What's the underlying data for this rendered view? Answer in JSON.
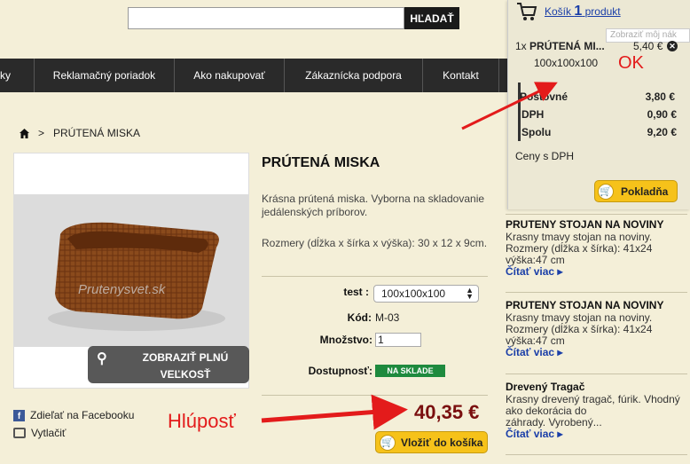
{
  "search": {
    "value": "",
    "button_label": "HĽADAŤ"
  },
  "nav": {
    "items": [
      "ky",
      "Reklamačný poriadok",
      "Ako nakupovať",
      "Zákaznícka podpora",
      "Kontakt"
    ]
  },
  "breadcrumb": {
    "sep": ">",
    "current": "PRÚTENÁ MISKA"
  },
  "product": {
    "title": "PRÚTENÁ MISKA",
    "description": "Krásna prútená miska. Vyborna na skladovanie jedálenských príborov.",
    "dimensions": "Rozmery (dĺžka x šírka x výška): 30 x 12 x 9cm.",
    "image_watermark": "Prutenysvet.sk",
    "zoom_label": "ZOBRAZIŤ PLNÚ VEĽKOSŤ",
    "option_label": "test :",
    "option_value": "100x100x100",
    "code_label": "Kód:",
    "code_value": "M-03",
    "qty_label": "Množstvo:",
    "qty_value": "1",
    "avail_label": "Dostupnosť:",
    "avail_badge": "NA SKLADE",
    "price": "40,35 €",
    "add_to_cart": "Vložiť do košíka"
  },
  "share": {
    "facebook": "Zdieľať na Facebooku",
    "print": "Vytlačiť"
  },
  "annotations": {
    "left": "Hlúposť",
    "right": "OK",
    "color": "#e31b1b"
  },
  "cart": {
    "link_prefix": "Košík",
    "count": "1",
    "link_suffix": "produkt",
    "tooltip": "Zobraziť môj nák",
    "item_qty": "1x",
    "item_name": "PRÚTENÁ MI...",
    "item_price": "5,40 €",
    "item_variant": "100x100x100",
    "totals": [
      {
        "label": "Poštovné",
        "value": "3,80 €"
      },
      {
        "label": "DPH",
        "value": "0,90 €"
      },
      {
        "label": "Spolu",
        "value": "9,20 €"
      }
    ],
    "vat_note": "Ceny s DPH",
    "checkout": "Pokladňa"
  },
  "sidebar_products": [
    {
      "title": "PRUTENY STOJAN NA NOVINY",
      "desc": "Krasny tmavy stojan na noviny.\nRozmery (dĺžka x šírka): 41x24\n výška:47 cm",
      "more": "Čítať viac ▸"
    },
    {
      "title": "PRUTENY STOJAN NA NOVINY",
      "desc": "Krasny tmavy stojan na noviny.\nRozmery (dĺžka x šírka): 41x24\n výška:47 cm",
      "more": "Čítať viac ▸"
    },
    {
      "title": "Drevený Tragač",
      "desc": "Krasny drevený tragač, fúrik. Vhodný\nako dekorácia do\nzáhrady. Vyrobený...",
      "more": "Čítať viac ▸"
    }
  ]
}
